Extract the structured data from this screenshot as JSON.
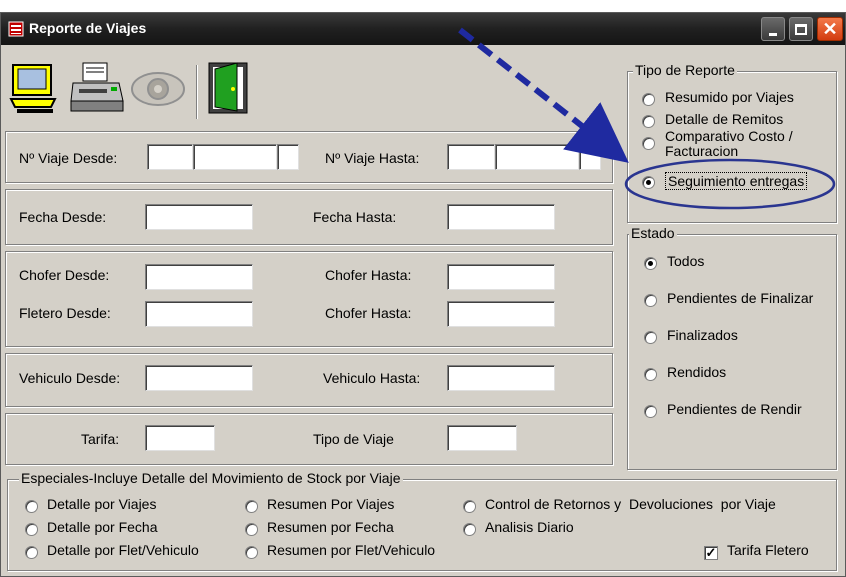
{
  "window": {
    "title": "Reporte de Viajes"
  },
  "toolbar": {
    "buttons": [
      {
        "name": "screen-preview",
        "icon": "monitor-icon"
      },
      {
        "name": "print",
        "icon": "printer-icon"
      },
      {
        "name": "view",
        "icon": "eye-icon"
      },
      {
        "name": "exit",
        "icon": "door-exit-icon"
      }
    ]
  },
  "filters": {
    "viaje_desde": "Nº Viaje Desde:",
    "viaje_hasta": "Nº Viaje Hasta:",
    "fecha_desde": "Fecha Desde:",
    "fecha_hasta": "Fecha Hasta:",
    "chofer_desde": "Chofer Desde:",
    "chofer_hasta": "Chofer Hasta:",
    "fletero_desde": "Fletero Desde:",
    "fletero_chofer_hasta": "Chofer Hasta:",
    "vehiculo_desde": "Vehiculo Desde:",
    "vehiculo_hasta": "Vehiculo Hasta:",
    "tarifa": "Tarifa:",
    "tipo_viaje": "Tipo de Viaje"
  },
  "tipo_reporte": {
    "legend": "Tipo de Reporte",
    "options": [
      "Resumido por Viajes",
      "Detalle de Remitos",
      "Comparativo Costo / Facturacion",
      "Seguimiento entregas"
    ],
    "selected": "Seguimiento entregas"
  },
  "estado": {
    "legend": "Estado",
    "options": [
      "Todos",
      "Pendientes de Finalizar",
      "Finalizados",
      "Rendidos",
      "Pendientes de Rendir"
    ],
    "selected": "Todos"
  },
  "especiales": {
    "legend": "Especiales-Incluye Detalle del Movimiento de Stock por Viaje",
    "options": [
      "Detalle por Viajes",
      "Detalle por Fecha",
      "Detalle por Flet/Vehiculo",
      "Resumen Por Viajes",
      "Resumen por Fecha",
      "Resumen por Flet/Vehiculo",
      "Control de Retornos y  Devoluciones  por Viaje",
      "Analisis Diario"
    ],
    "tarifa_fletero": {
      "label": "Tarifa Fletero",
      "checked": true
    }
  },
  "colors": {
    "annotation_arrow": "#1f2aa0",
    "highlight_ellipse": "#2a3590",
    "titlebar": "#202020",
    "dialog_bg": "#d4d0c8"
  }
}
